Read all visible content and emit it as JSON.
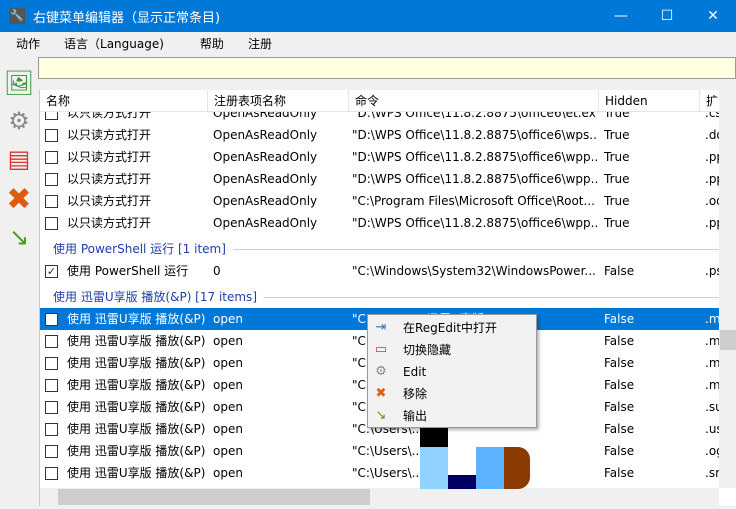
{
  "window": {
    "title": "右键菜单编辑器（显示正常条目)",
    "minimize": "—",
    "maximize": "☐",
    "close": "✕"
  },
  "menu": [
    "动作",
    "语言（Language)",
    "帮助",
    "注册"
  ],
  "search": {
    "value": "",
    "placeholder": ""
  },
  "columns": [
    "名称",
    "注册表项名称",
    "命令",
    "Hidden",
    "扩"
  ],
  "groups": [
    {
      "label": "",
      "rows": [
        {
          "checked": false,
          "name": "以只读方式打开",
          "key": "OpenAsReadOnly",
          "cmd": "\"D:\\WPS Office\\11.8.2.8875\\office6\\et.ex...",
          "hidden": "True",
          "ext": ".cs"
        },
        {
          "checked": false,
          "name": "以只读方式打开",
          "key": "OpenAsReadOnly",
          "cmd": "\"D:\\WPS Office\\11.8.2.8875\\office6\\wps....",
          "hidden": "True",
          "ext": ".do"
        },
        {
          "checked": false,
          "name": "以只读方式打开",
          "key": "OpenAsReadOnly",
          "cmd": "\"D:\\WPS Office\\11.8.2.8875\\office6\\wpp....",
          "hidden": "True",
          "ext": ".pp"
        },
        {
          "checked": false,
          "name": "以只读方式打开",
          "key": "OpenAsReadOnly",
          "cmd": "\"D:\\WPS Office\\11.8.2.8875\\office6\\wpp....",
          "hidden": "True",
          "ext": ".pp"
        },
        {
          "checked": false,
          "name": "以只读方式打开",
          "key": "OpenAsReadOnly",
          "cmd": "\"C:\\Program Files\\Microsoft Office\\Root...",
          "hidden": "True",
          "ext": ".od"
        },
        {
          "checked": false,
          "name": "以只读方式打开",
          "key": "OpenAsReadOnly",
          "cmd": "\"D:\\WPS Office\\11.8.2.8875\\office6\\wpp....",
          "hidden": "True",
          "ext": ".pp"
        }
      ]
    },
    {
      "label": "使用 PowerShell 运行 [1 item]",
      "rows": [
        {
          "checked": true,
          "name": "使用 PowerShell 运行",
          "key": "0",
          "cmd": "\"C:\\Windows\\System32\\WindowsPower...",
          "hidden": "False",
          "ext": ".ps"
        }
      ]
    },
    {
      "label": "使用 迅雷U享版 播放(&P) [17 items]",
      "rows": [
        {
          "checked": false,
          "selected": true,
          "name": "使用 迅雷U享版 播放(&P)",
          "key": "open",
          "cmd": "\"C:\\Users\\...\\迅雷U享版...",
          "hidden": "False",
          "ext": ".m"
        },
        {
          "checked": false,
          "name": "使用 迅雷U享版 播放(&P)",
          "key": "open",
          "cmd": "\"C:\\Users\\...\\迅雷U享版...",
          "hidden": "False",
          "ext": ".m"
        },
        {
          "checked": false,
          "name": "使用 迅雷U享版 播放(&P)",
          "key": "open",
          "cmd": "\"C:\\Users\\...\\迅雷U享版...",
          "hidden": "False",
          "ext": ".m"
        },
        {
          "checked": false,
          "name": "使用 迅雷U享版 播放(&P)",
          "key": "open",
          "cmd": "\"C:\\Users\\...\\迅雷U享版...",
          "hidden": "False",
          "ext": ".m"
        },
        {
          "checked": false,
          "name": "使用 迅雷U享版 播放(&P)",
          "key": "open",
          "cmd": "\"C:\\Users\\...\\迅雷U享版...",
          "hidden": "False",
          "ext": ".su"
        },
        {
          "checked": false,
          "name": "使用 迅雷U享版 播放(&P)",
          "key": "open",
          "cmd": "\"C:\\Users\\...\\迅雷U享版...",
          "hidden": "False",
          "ext": ".us"
        },
        {
          "checked": false,
          "name": "使用 迅雷U享版 播放(&P)",
          "key": "open",
          "cmd": "\"C:\\Users\\...\\迅雷U享版...",
          "hidden": "False",
          "ext": ".og"
        },
        {
          "checked": false,
          "name": "使用 迅雷U享版 播放(&P)",
          "key": "open",
          "cmd": "\"C:\\Users\\...\\迅雷U享版...",
          "hidden": "False",
          "ext": ".sr"
        }
      ]
    }
  ],
  "context_menu": [
    {
      "label": "在RegEdit中打开",
      "icon": "regedit-icon",
      "glyph": "⇥",
      "color": "#3a6fb0"
    },
    {
      "label": "切换隐藏",
      "icon": "toggle-hide-icon",
      "glyph": "▭",
      "color": "#d33"
    },
    {
      "label": "Edit",
      "icon": "gear-icon",
      "glyph": "⚙",
      "color": "#888"
    },
    {
      "label": "移除",
      "icon": "remove-icon",
      "glyph": "✖",
      "color": "#e06010"
    },
    {
      "label": "输出",
      "icon": "export-icon",
      "glyph": "↘",
      "color": "#4a9a20"
    }
  ],
  "colors": {
    "accent": "#0078d7",
    "search_bg": "#ffffe1",
    "group_text": "#1e3ea8"
  }
}
